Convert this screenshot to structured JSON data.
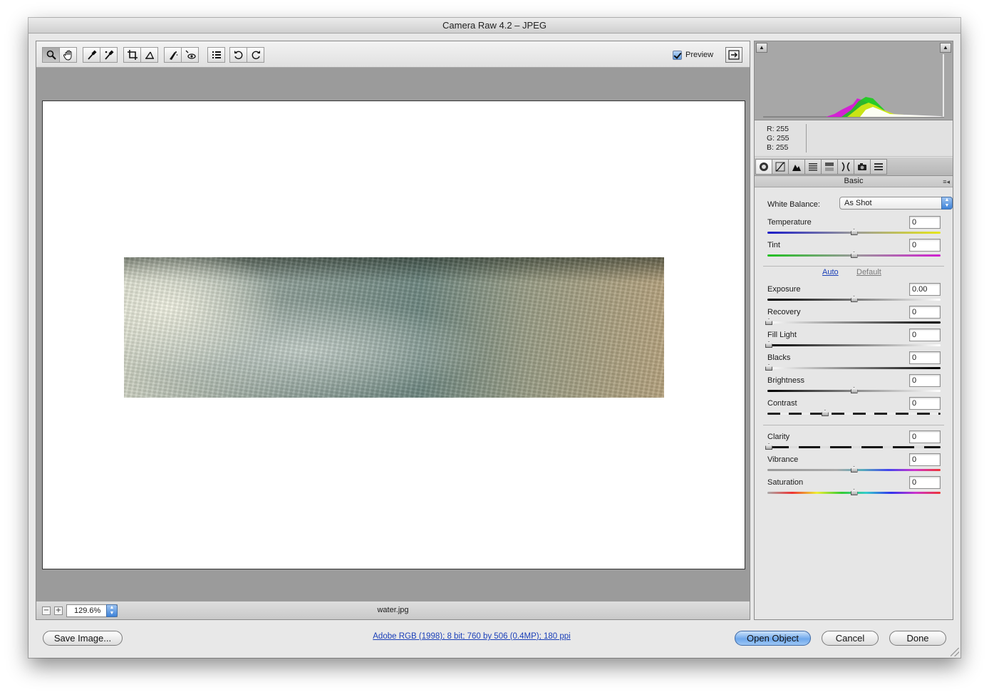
{
  "window": {
    "title": "Camera Raw 4.2  –  JPEG"
  },
  "toolbar": {
    "tools": [
      {
        "icon": "zoom-icon",
        "active": true
      },
      {
        "icon": "hand-icon"
      },
      {
        "icon": "white-balance-icon"
      },
      {
        "icon": "color-sampler-icon"
      },
      {
        "icon": "crop-icon"
      },
      {
        "icon": "straighten-icon"
      },
      {
        "icon": "retouch-icon"
      },
      {
        "icon": "red-eye-icon"
      },
      {
        "icon": "preferences-icon"
      },
      {
        "icon": "rotate-left-icon"
      },
      {
        "icon": "rotate-right-icon"
      }
    ],
    "preview_label": "Preview",
    "preview_checked": true
  },
  "image": {
    "filename": "water.jpg"
  },
  "zoom": {
    "value": "129.6%",
    "minus_icon": "minus-icon",
    "plus_icon": "plus-icon"
  },
  "readout": {
    "r": "R:  255",
    "g": "G:  255",
    "b": "B:  255"
  },
  "panel": {
    "title": "Basic",
    "tabs": [
      "basic-icon",
      "tone-curve-icon",
      "detail-icon",
      "hsl-icon",
      "split-toning-icon",
      "lens-icon",
      "camera-calibration-icon",
      "presets-icon"
    ],
    "white_balance_label": "White Balance:",
    "white_balance_value": "As Shot",
    "auto_label": "Auto",
    "default_label": "Default",
    "sliders": [
      {
        "label": "Temperature",
        "value": "0",
        "pos": 0.5
      },
      {
        "label": "Tint",
        "value": "0",
        "pos": 0.5
      },
      {
        "label": "Exposure",
        "value": "0.00",
        "pos": 0.5
      },
      {
        "label": "Recovery",
        "value": "0",
        "pos": 0.0
      },
      {
        "label": "Fill Light",
        "value": "0",
        "pos": 0.0
      },
      {
        "label": "Blacks",
        "value": "0",
        "pos": 0.0
      },
      {
        "label": "Brightness",
        "value": "0",
        "pos": 0.5
      },
      {
        "label": "Contrast",
        "value": "0",
        "pos": 0.33
      },
      {
        "label": "Clarity",
        "value": "0",
        "pos": 0.0
      },
      {
        "label": "Vibrance",
        "value": "0",
        "pos": 0.5
      },
      {
        "label": "Saturation",
        "value": "0",
        "pos": 0.5
      }
    ]
  },
  "footer": {
    "save_label": "Save Image...",
    "info_link": "Adobe RGB (1998); 8 bit; 760 by 506 (0.4MP); 180 ppi",
    "open_label": "Open Object",
    "cancel_label": "Cancel",
    "done_label": "Done"
  }
}
